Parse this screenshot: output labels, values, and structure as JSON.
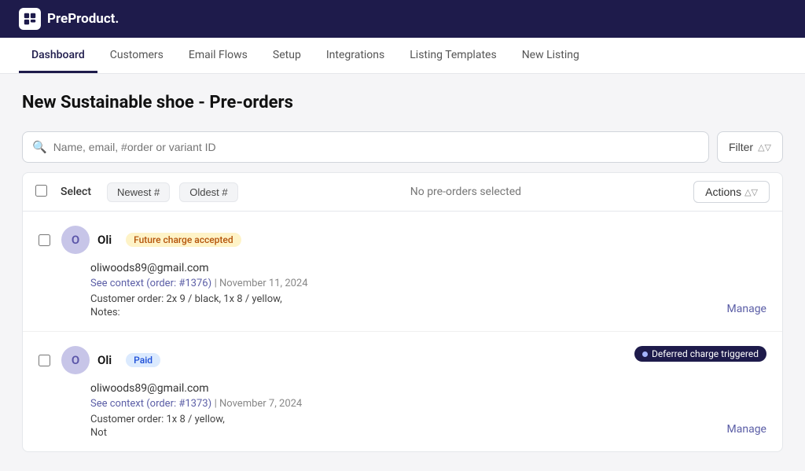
{
  "app": {
    "name": "PreProduct."
  },
  "topnav": {
    "items": [
      {
        "id": "dashboard",
        "label": "Dashboard",
        "active": true
      },
      {
        "id": "customers",
        "label": "Customers",
        "active": false
      },
      {
        "id": "email-flows",
        "label": "Email Flows",
        "active": false
      },
      {
        "id": "setup",
        "label": "Setup",
        "active": false
      },
      {
        "id": "integrations",
        "label": "Integrations",
        "active": false
      },
      {
        "id": "listing-templates",
        "label": "Listing Templates",
        "active": false
      },
      {
        "id": "new-listing",
        "label": "New Listing",
        "active": false
      }
    ]
  },
  "page": {
    "title": "New Sustainable shoe - Pre-orders"
  },
  "search": {
    "placeholder": "Name, email, #order or variant ID"
  },
  "toolbar": {
    "filter_label": "Filter",
    "select_label": "Select",
    "newest_label": "Newest #",
    "oldest_label": "Oldest #",
    "no_selection": "No pre-orders selected",
    "actions_label": "Actions"
  },
  "orders": [
    {
      "id": "order-1",
      "avatar_initial": "O",
      "customer_name": "Oli",
      "badge_label": "Future charge accepted",
      "badge_type": "yellow",
      "email": "oliwoods89@gmail.com",
      "order_link_text": "See context (order: #1376)",
      "order_link_href": "#1376",
      "date": "November 11, 2024",
      "customer_order": "Customer order: 2x 9 / black, 1x 8 / yellow,",
      "notes": "Notes:",
      "manage_label": "Manage",
      "deferred_badge": null
    },
    {
      "id": "order-2",
      "avatar_initial": "O",
      "customer_name": "Oli",
      "badge_label": "Paid",
      "badge_type": "blue",
      "email": "oliwoods89@gmail.com",
      "order_link_text": "See context (order: #1373)",
      "order_link_href": "#1373",
      "date": "November 7, 2024",
      "customer_order": "Customer order: 1x 8 / yellow,",
      "notes": "Not",
      "manage_label": "Manage",
      "deferred_badge": "Deferred charge triggered"
    }
  ]
}
